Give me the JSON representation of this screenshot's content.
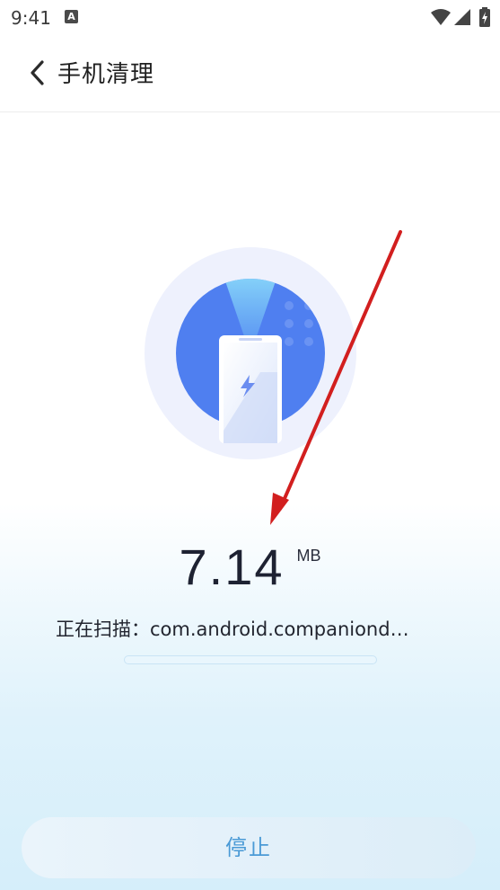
{
  "status_bar": {
    "time": "9:41",
    "notification_icon": "a-icon",
    "icons": [
      "wifi-icon",
      "signal-icon",
      "battery-charging-icon"
    ]
  },
  "header": {
    "back_icon": "chevron-left-icon",
    "title": "手机清理"
  },
  "illustration": {
    "icon": "phone-scan-icon",
    "colors": {
      "outer_ring": "#eef1fd",
      "disc": "#4f7ff0",
      "beam": "#7fd0f8"
    }
  },
  "scan": {
    "size_value": "7.14",
    "size_unit": "MB",
    "status_text": "正在扫描：com.android.companiond…",
    "progress": 0
  },
  "actions": {
    "stop_label": "停止"
  },
  "colors": {
    "accent": "#4a9ad6",
    "annotation_arrow": "#d21f1f"
  }
}
